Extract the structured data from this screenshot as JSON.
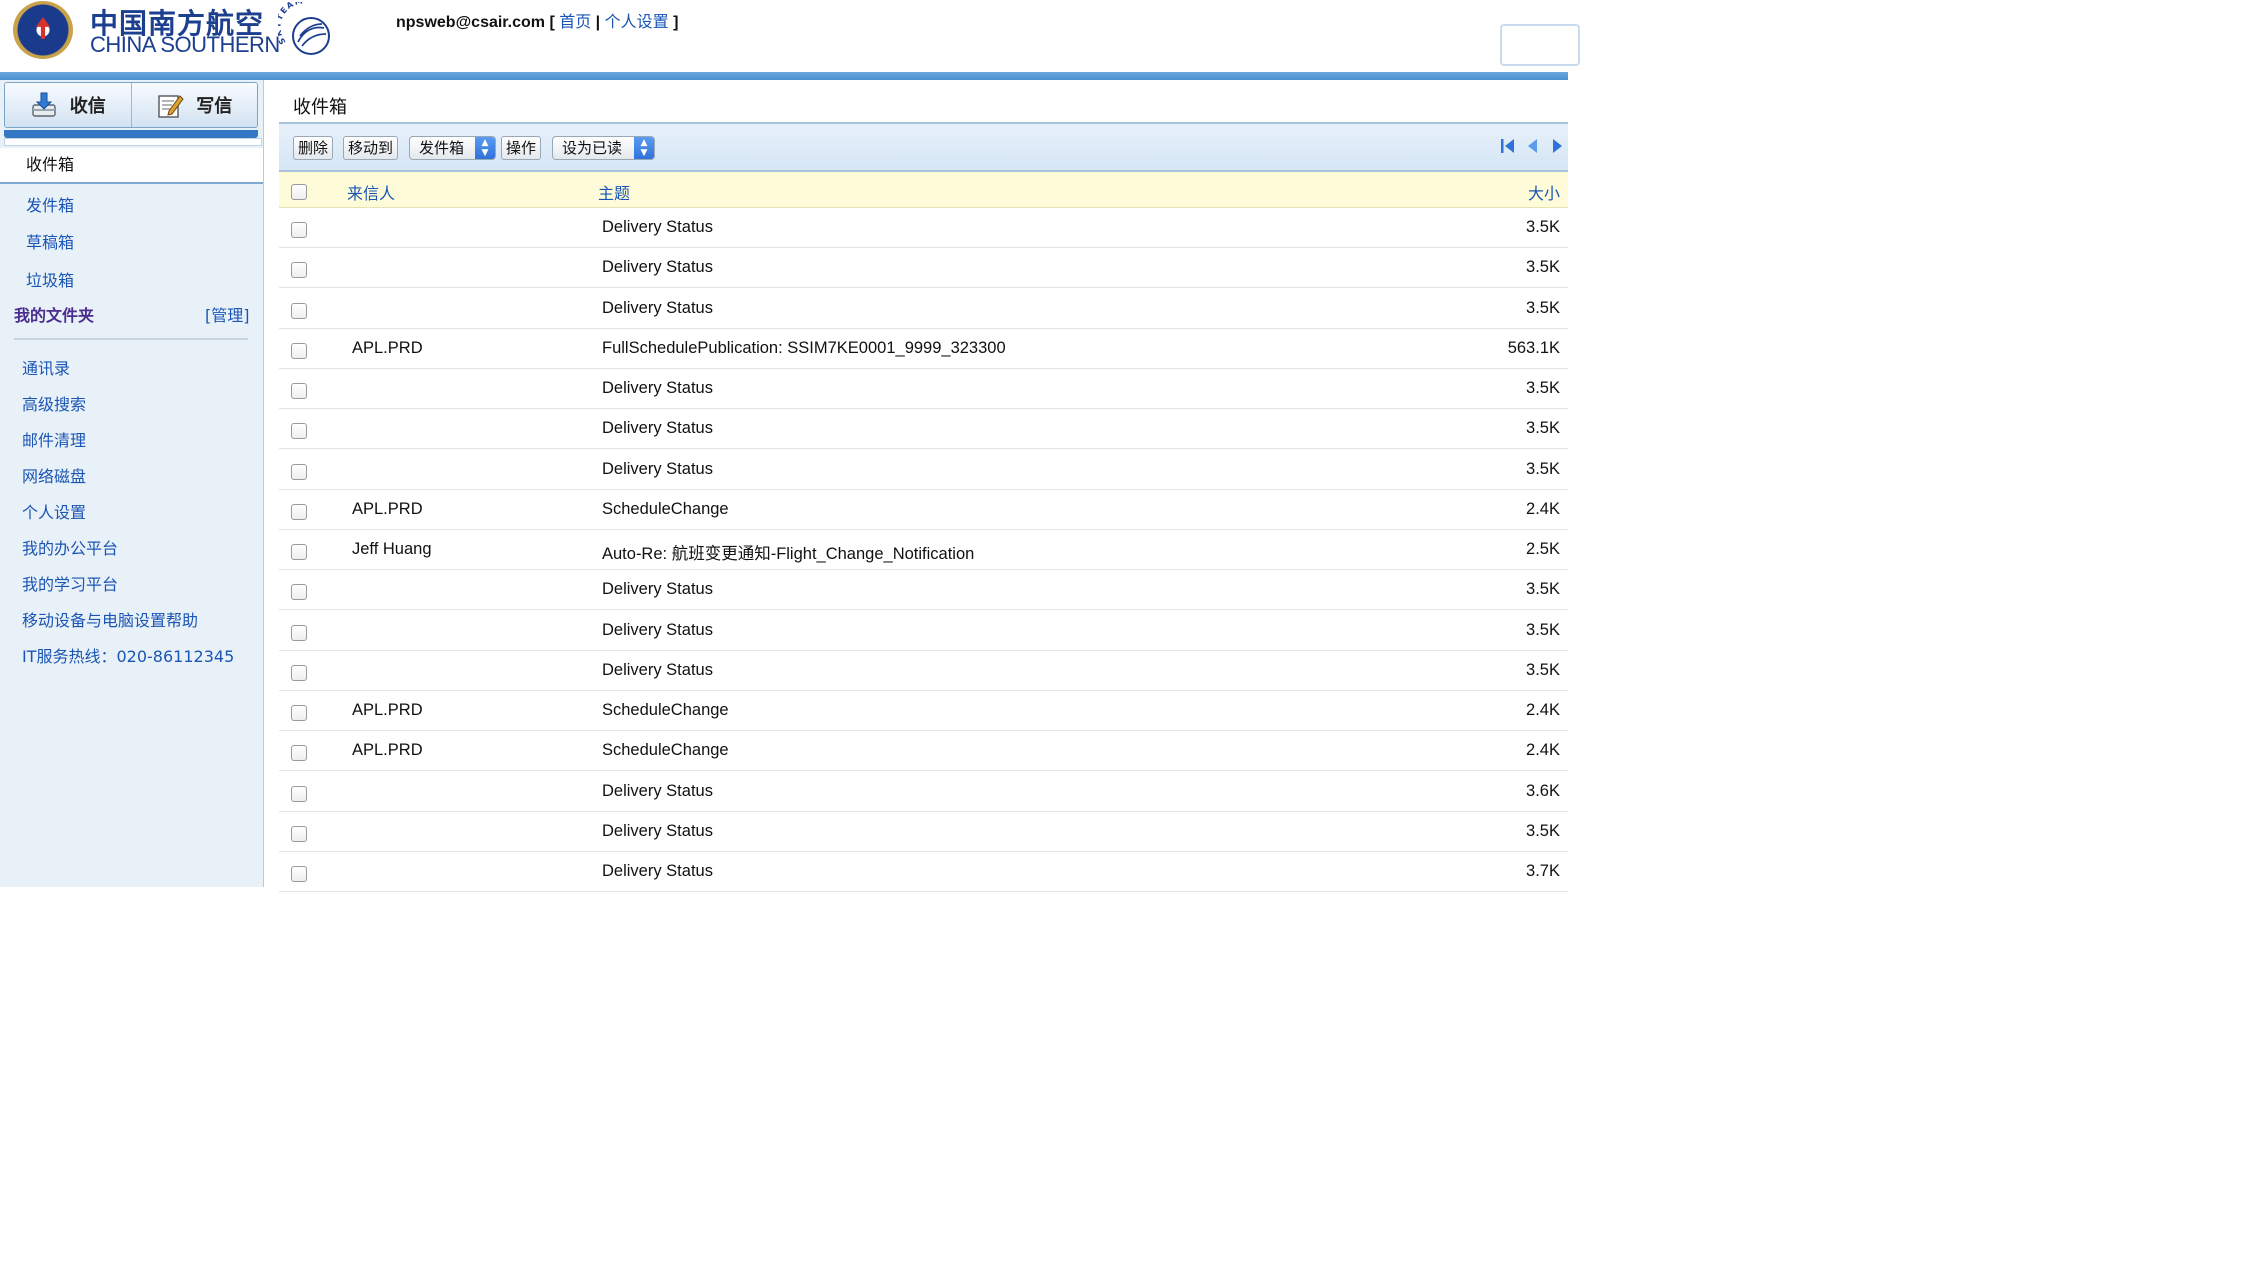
{
  "header": {
    "logo_cn": "中国南方航空",
    "logo_en": "CHINA SOUTHERN",
    "alliance_logo": "SKYTEAM",
    "user_email": "npsweb@csair.com",
    "bracket_open": " [ ",
    "home_link": "首页",
    "sep": " | ",
    "settings_link": "个人设置",
    "bracket_close": " ]"
  },
  "sidebar": {
    "receive_label": "收信",
    "compose_label": "写信",
    "current_folder": "收件箱",
    "folders": [
      "发件箱",
      "草稿箱",
      "垃圾箱"
    ],
    "my_folders_label": "我的文件夹",
    "manage_label": "[管理]",
    "tools": [
      "通讯录",
      "高级搜索",
      "邮件清理",
      "网络磁盘",
      "个人设置",
      "我的办公平台",
      "我的学习平台",
      "移动设备与电脑设置帮助",
      "IT服务热线：020-86112345"
    ]
  },
  "main": {
    "title": "收件箱",
    "toolbar": {
      "delete_label": "删除",
      "move_to_label": "移动到",
      "move_target": "发件箱",
      "action_label": "操作",
      "mark_as": "设为已读"
    },
    "columns": {
      "from": "来信人",
      "subject": "主题",
      "size": "大小"
    },
    "messages": [
      {
        "from": "",
        "subject": "Delivery Status",
        "size": "3.5K"
      },
      {
        "from": "",
        "subject": "Delivery Status",
        "size": "3.5K"
      },
      {
        "from": "",
        "subject": "Delivery Status",
        "size": "3.5K"
      },
      {
        "from": "APL.PRD",
        "subject": "FullSchedulePublication: SSIM7KE0001_9999_323300",
        "size": "563.1K"
      },
      {
        "from": "",
        "subject": "Delivery Status",
        "size": "3.5K"
      },
      {
        "from": "",
        "subject": "Delivery Status",
        "size": "3.5K"
      },
      {
        "from": "",
        "subject": "Delivery Status",
        "size": "3.5K"
      },
      {
        "from": "APL.PRD",
        "subject": "ScheduleChange",
        "size": "2.4K"
      },
      {
        "from": "Jeff Huang",
        "subject": "Auto-Re: 航班变更通知-Flight_Change_Notification",
        "size": "2.5K"
      },
      {
        "from": "",
        "subject": "Delivery Status",
        "size": "3.5K"
      },
      {
        "from": "",
        "subject": "Delivery Status",
        "size": "3.5K"
      },
      {
        "from": "",
        "subject": "Delivery Status",
        "size": "3.5K"
      },
      {
        "from": "APL.PRD",
        "subject": "ScheduleChange",
        "size": "2.4K"
      },
      {
        "from": "APL.PRD",
        "subject": "ScheduleChange",
        "size": "2.4K"
      },
      {
        "from": "",
        "subject": "Delivery Status",
        "size": "3.6K"
      },
      {
        "from": "",
        "subject": "Delivery Status",
        "size": "3.5K"
      },
      {
        "from": "",
        "subject": "Delivery Status",
        "size": "3.7K"
      }
    ]
  },
  "colors": {
    "brand_blue": "#1d3f8f",
    "link_blue": "#1a55b5",
    "header_rule": "#4a8fd1",
    "sidebar_bg": "#e9f1f8",
    "table_header_bg": "#fdfbd8"
  },
  "icons": {
    "receive": "inbox-download-icon",
    "compose": "compose-pencil-icon",
    "pager_first": "first-page-icon",
    "pager_prev": "prev-page-icon",
    "pager_next": "next-page-icon",
    "select_arrow": "select-updown-icon"
  }
}
